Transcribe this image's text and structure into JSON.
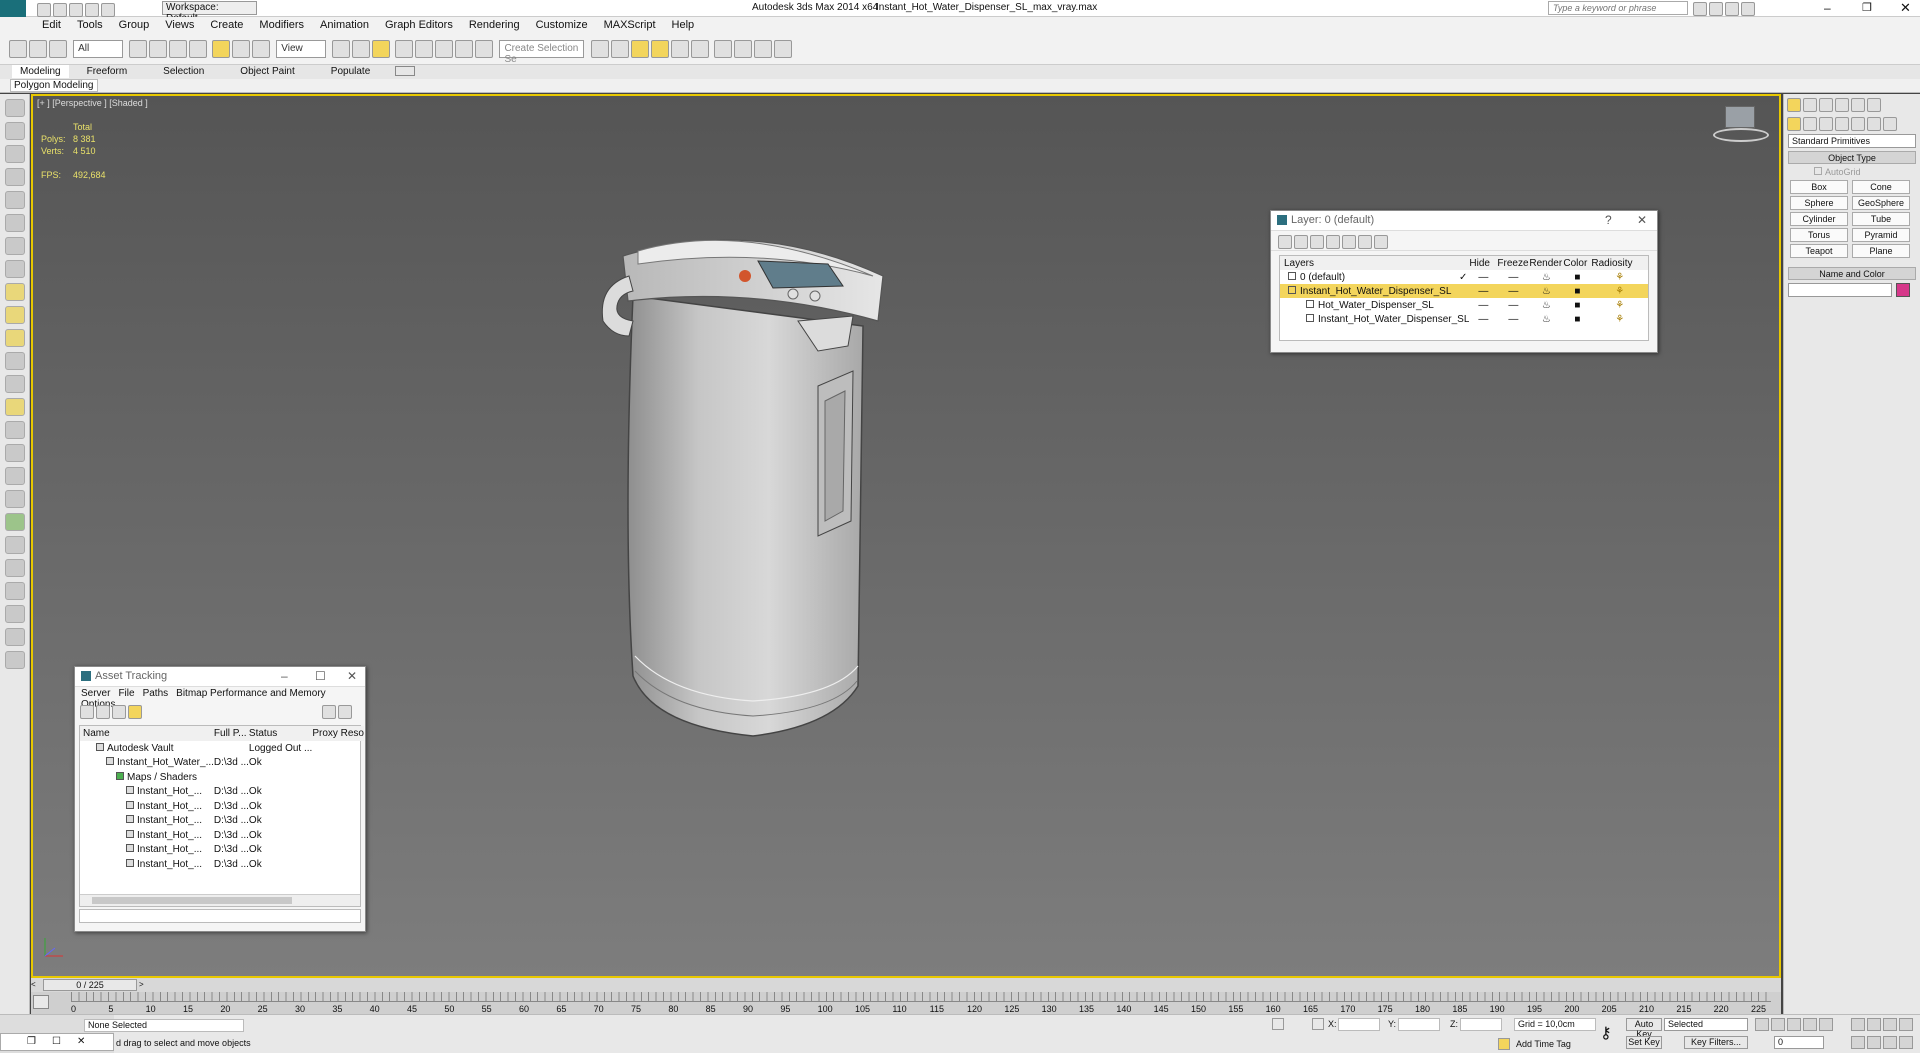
{
  "titlebar": {
    "app": "Autodesk 3ds Max  2014 x64",
    "file": "Instant_Hot_Water_Dispenser_SL_max_vray.max",
    "workspace": "Workspace: Default",
    "search_placeholder": "Type a keyword or phrase"
  },
  "menu": [
    "Edit",
    "Tools",
    "Group",
    "Views",
    "Create",
    "Modifiers",
    "Animation",
    "Graph Editors",
    "Rendering",
    "Customize",
    "MAXScript",
    "Help"
  ],
  "toolbar": {
    "filter": "All",
    "ref_coord": "View",
    "selection_set": "Create Selection Se"
  },
  "ribbon": {
    "tabs": [
      "Modeling",
      "Freeform",
      "Selection",
      "Object Paint",
      "Populate"
    ],
    "sub": "Polygon Modeling"
  },
  "viewport": {
    "label": "[+ ] [Perspective ] [Shaded ]",
    "stats": {
      "total": "Total",
      "polys_label": "Polys:",
      "polys": "8 381",
      "verts_label": "Verts:",
      "verts": "4 510",
      "fps_label": "FPS:",
      "fps": "492,684"
    }
  },
  "layer_dialog": {
    "title": "Layer: 0 (default)",
    "columns": [
      "Layers",
      "Hide",
      "Freeze",
      "Render",
      "Color",
      "Radiosity"
    ],
    "rows": [
      {
        "name": "0 (default)",
        "indent": 0,
        "current": true,
        "highlight": false
      },
      {
        "name": "Instant_Hot_Water_Dispenser_SL",
        "indent": 0,
        "current": false,
        "highlight": true
      },
      {
        "name": "Hot_Water_Dispenser_SL",
        "indent": 1,
        "current": false,
        "highlight": false
      },
      {
        "name": "Instant_Hot_Water_Dispenser_SL",
        "indent": 1,
        "current": false,
        "highlight": false
      }
    ]
  },
  "asset_tracking": {
    "title": "Asset Tracking",
    "menu": [
      "Server",
      "File",
      "Paths",
      "Bitmap Performance and Memory",
      "Options"
    ],
    "columns": [
      "Name",
      "Full P...",
      "Status",
      "Proxy Reso"
    ],
    "rows": [
      {
        "name": "Autodesk Vault",
        "path": "",
        "status": "Logged Out ...",
        "level": 0
      },
      {
        "name": "Instant_Hot_Water_...",
        "path": "D:\\3d ...",
        "status": "Ok",
        "level": 1
      },
      {
        "name": "Maps / Shaders",
        "path": "",
        "status": "",
        "level": 2
      },
      {
        "name": "Instant_Hot_...",
        "path": "D:\\3d ...",
        "status": "Ok",
        "level": 3
      },
      {
        "name": "Instant_Hot_...",
        "path": "D:\\3d ...",
        "status": "Ok",
        "level": 3
      },
      {
        "name": "Instant_Hot_...",
        "path": "D:\\3d ...",
        "status": "Ok",
        "level": 3
      },
      {
        "name": "Instant_Hot_...",
        "path": "D:\\3d ...",
        "status": "Ok",
        "level": 3
      },
      {
        "name": "Instant_Hot_...",
        "path": "D:\\3d ...",
        "status": "Ok",
        "level": 3
      },
      {
        "name": "Instant_Hot_...",
        "path": "D:\\3d ...",
        "status": "Ok",
        "level": 3
      }
    ]
  },
  "command_panel": {
    "category": "Standard Primitives",
    "object_type": "Object Type",
    "autogrid": "AutoGrid",
    "primitives": [
      "Box",
      "Cone",
      "Sphere",
      "GeoSphere",
      "Cylinder",
      "Tube",
      "Torus",
      "Pyramid",
      "Teapot",
      "Plane"
    ],
    "name_color": "Name and Color",
    "color": "#d6388a"
  },
  "timeline": {
    "frame": "0 / 225",
    "ticks": [
      "0",
      "5",
      "10",
      "15",
      "20",
      "25",
      "30",
      "35",
      "40",
      "45",
      "50",
      "55",
      "60",
      "65",
      "70",
      "75",
      "80",
      "85",
      "90",
      "95",
      "100",
      "105",
      "110",
      "115",
      "120",
      "125",
      "130",
      "135",
      "140",
      "145",
      "150",
      "155",
      "160",
      "165",
      "170",
      "175",
      "180",
      "185",
      "190",
      "195",
      "200",
      "205",
      "210",
      "215",
      "220",
      "225"
    ]
  },
  "status": {
    "selection": "None Selected",
    "prompt": "d drag to select and move objects",
    "x_label": "X:",
    "y_label": "Y:",
    "z_label": "Z:",
    "grid": "Grid = 10,0cm",
    "add_time_tag": "Add Time Tag",
    "auto_key": "Auto Key",
    "selected": "Selected",
    "set_key": "Set Key",
    "key_filters": "Key Filters...",
    "frame_field": "0"
  }
}
